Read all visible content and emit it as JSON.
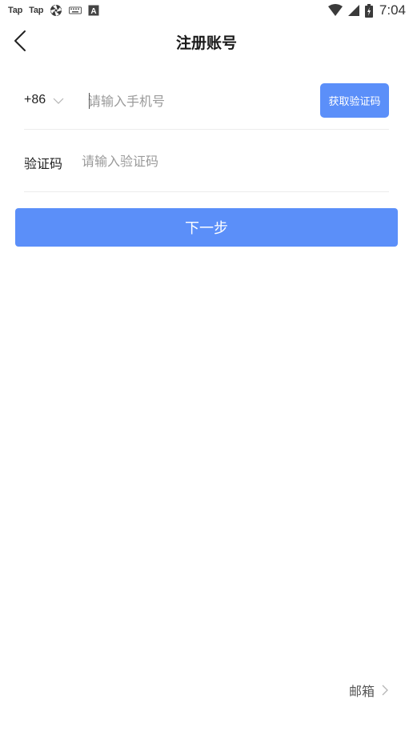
{
  "status_bar": {
    "left_labels": [
      "Tap",
      "Tap"
    ],
    "time": "7:04",
    "icons": [
      "tap-logo",
      "tap-logo",
      "aperture-icon",
      "keyboard-icon",
      "a-box-icon",
      "wifi-icon",
      "signal-icon",
      "battery-icon"
    ]
  },
  "header": {
    "title": "注册账号",
    "back_icon": "chevron-left-icon"
  },
  "phone": {
    "country_code": "+86",
    "placeholder": "请输入手机号",
    "value": "",
    "get_code_label": "获取验证码"
  },
  "code": {
    "label": "验证码",
    "placeholder": "请输入验证码",
    "value": ""
  },
  "next_label": "下一步",
  "footer": {
    "email_label": "邮箱"
  },
  "colors": {
    "primary": "#5b8ff9",
    "divider": "#ececec",
    "placeholder": "#9a9a9a"
  }
}
